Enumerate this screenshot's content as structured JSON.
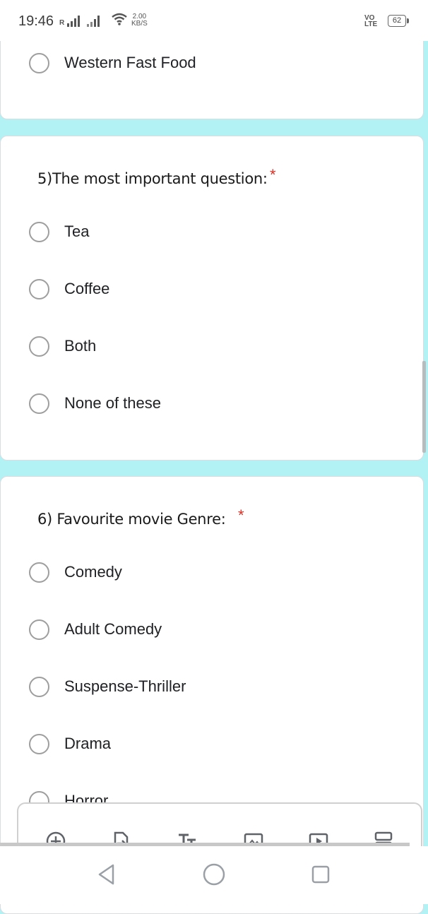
{
  "status_bar": {
    "time": "19:46",
    "network_speed_value": "2.00",
    "network_speed_unit": "KB/S",
    "volte_top": "VO",
    "volte_bottom": "LTE",
    "battery": "62"
  },
  "form": {
    "previous_question_last_option": "Western Fast Food",
    "questions": [
      {
        "title": "5)The most important question:",
        "required_mark": "*",
        "options": [
          "Tea",
          "Coffee",
          "Both",
          "None of these"
        ]
      },
      {
        "title": "6) Favourite movie Genre:",
        "required_mark": "*",
        "options": [
          "Comedy",
          "Adult Comedy",
          "Suspense-Thriller",
          "Drama",
          "Horror"
        ]
      }
    ]
  },
  "toolbar": {
    "icons": [
      "add-question-icon",
      "import-questions-icon",
      "add-title-icon",
      "add-image-icon",
      "add-video-icon",
      "add-section-icon"
    ]
  },
  "navbar": {
    "icons": [
      "back-icon",
      "home-icon",
      "recents-icon"
    ]
  },
  "colors": {
    "background": "#b2f1f4",
    "required": "#d93025",
    "radio_border": "#9e9e9e"
  }
}
